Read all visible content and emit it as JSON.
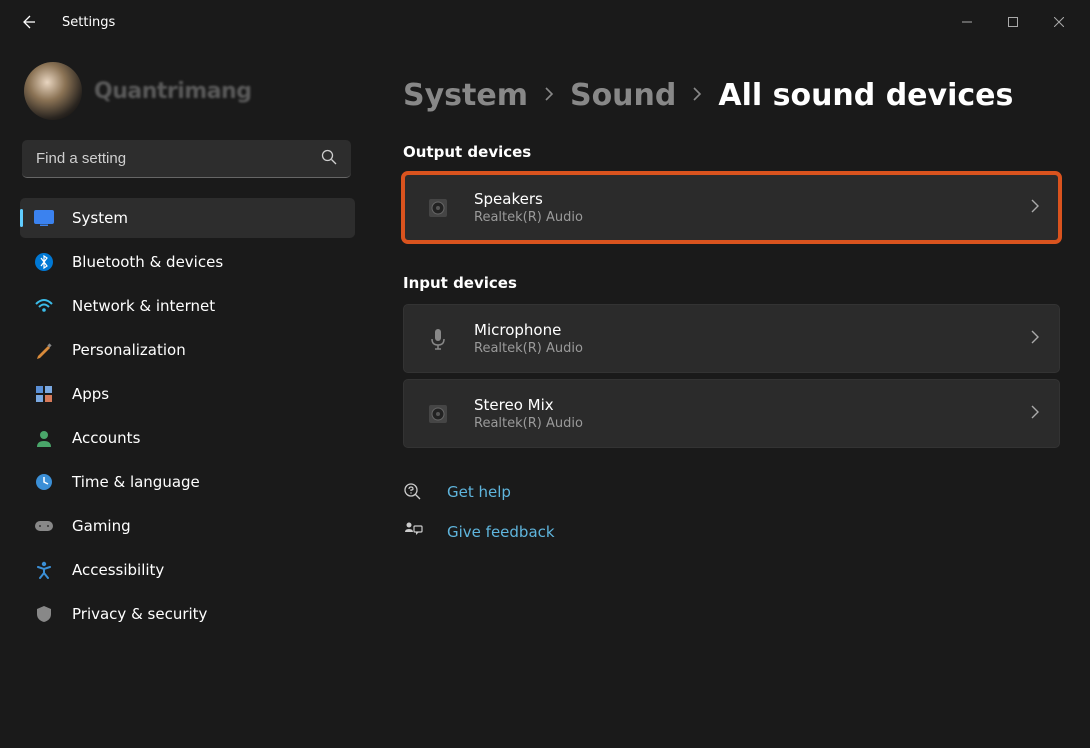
{
  "app": {
    "title": "Settings",
    "watermark": "Quantrimang"
  },
  "search": {
    "placeholder": "Find a setting"
  },
  "sidebar": {
    "items": [
      {
        "label": "System"
      },
      {
        "label": "Bluetooth & devices"
      },
      {
        "label": "Network & internet"
      },
      {
        "label": "Personalization"
      },
      {
        "label": "Apps"
      },
      {
        "label": "Accounts"
      },
      {
        "label": "Time & language"
      },
      {
        "label": "Gaming"
      },
      {
        "label": "Accessibility"
      },
      {
        "label": "Privacy & security"
      }
    ]
  },
  "breadcrumb": {
    "level1": "System",
    "level2": "Sound",
    "current": "All sound devices"
  },
  "sections": {
    "output_title": "Output devices",
    "input_title": "Input devices"
  },
  "devices": {
    "output": [
      {
        "name": "Speakers",
        "driver": "Realtek(R) Audio"
      }
    ],
    "input": [
      {
        "name": "Microphone",
        "driver": "Realtek(R) Audio"
      },
      {
        "name": "Stereo Mix",
        "driver": "Realtek(R) Audio"
      }
    ]
  },
  "help": {
    "get_help": "Get help",
    "feedback": "Give feedback"
  }
}
